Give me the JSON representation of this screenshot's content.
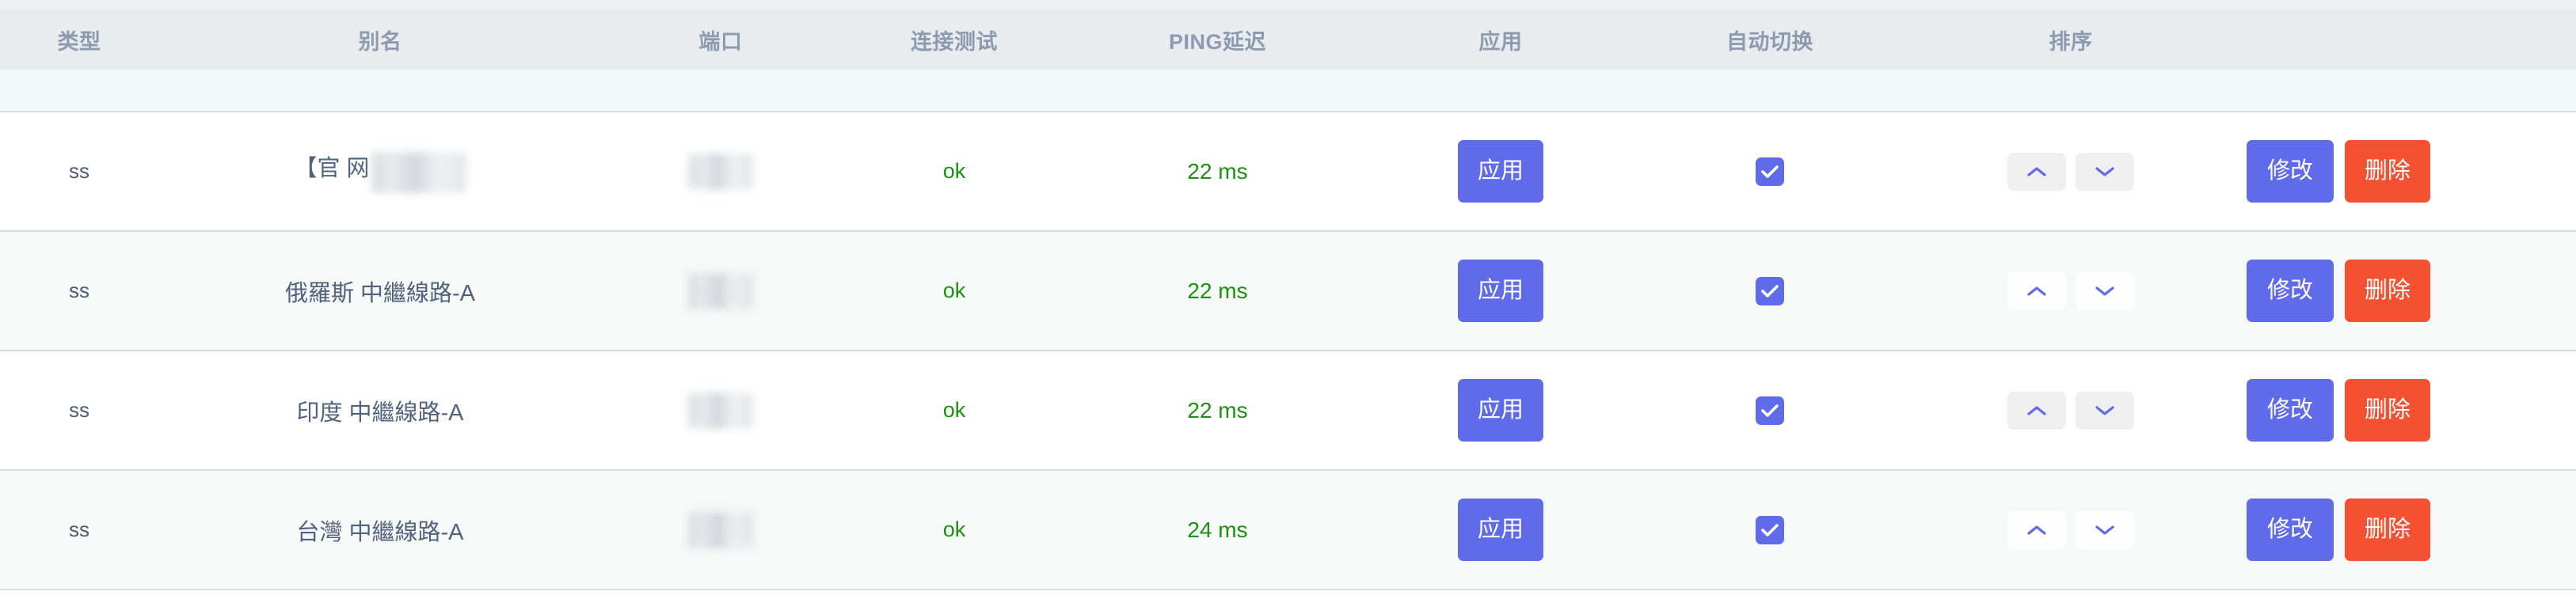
{
  "table": {
    "columns": [
      {
        "key": "type",
        "label": "类型"
      },
      {
        "key": "alias",
        "label": "别名"
      },
      {
        "key": "port",
        "label": "端口"
      },
      {
        "key": "test",
        "label": "连接测试"
      },
      {
        "key": "ping",
        "label": "PING延迟"
      },
      {
        "key": "apply",
        "label": "应用"
      },
      {
        "key": "auto",
        "label": "自动切换"
      },
      {
        "key": "sort",
        "label": "排序"
      },
      {
        "key": "actions",
        "label": ""
      }
    ],
    "rows": [
      {
        "type": "ss",
        "alias": "【官 网",
        "alias_redacted": true,
        "port": "",
        "port_redacted": true,
        "test": "ok",
        "ping": "22 ms",
        "apply_label": "应用",
        "auto_switch_checked": true,
        "sort_up_icon": "chevron-up-icon",
        "sort_down_icon": "chevron-down-icon",
        "edit_label": "修改",
        "delete_label": "删除"
      },
      {
        "type": "ss",
        "alias": "俄羅斯 中繼線路-A",
        "alias_redacted": false,
        "port": "",
        "port_redacted": true,
        "test": "ok",
        "ping": "22 ms",
        "apply_label": "应用",
        "auto_switch_checked": true,
        "sort_up_icon": "chevron-up-icon",
        "sort_down_icon": "chevron-down-icon",
        "edit_label": "修改",
        "delete_label": "删除"
      },
      {
        "type": "ss",
        "alias": "印度 中繼線路-A",
        "alias_redacted": false,
        "port": "",
        "port_redacted": true,
        "test": "ok",
        "ping": "22 ms",
        "apply_label": "应用",
        "auto_switch_checked": true,
        "sort_up_icon": "chevron-up-icon",
        "sort_down_icon": "chevron-down-icon",
        "edit_label": "修改",
        "delete_label": "删除"
      },
      {
        "type": "ss",
        "alias": "台灣 中繼線路-A",
        "alias_redacted": false,
        "port": "",
        "port_redacted": true,
        "test": "ok",
        "ping": "24 ms",
        "apply_label": "应用",
        "auto_switch_checked": true,
        "sort_up_icon": "chevron-up-icon",
        "sort_down_icon": "chevron-down-icon",
        "edit_label": "修改",
        "delete_label": "删除"
      }
    ]
  },
  "colors": {
    "header_bg": "#e8ecee",
    "header_text": "#8e9aaf",
    "band_bg": "#f3f8fb",
    "row_odd_bg": "#ffffff",
    "row_even_bg": "#f7f8f8",
    "divider": "#dadcde",
    "accent_blue": "#606bea",
    "danger_red": "#f35132",
    "status_green": "#19930f",
    "alias_text": "#51627d"
  }
}
